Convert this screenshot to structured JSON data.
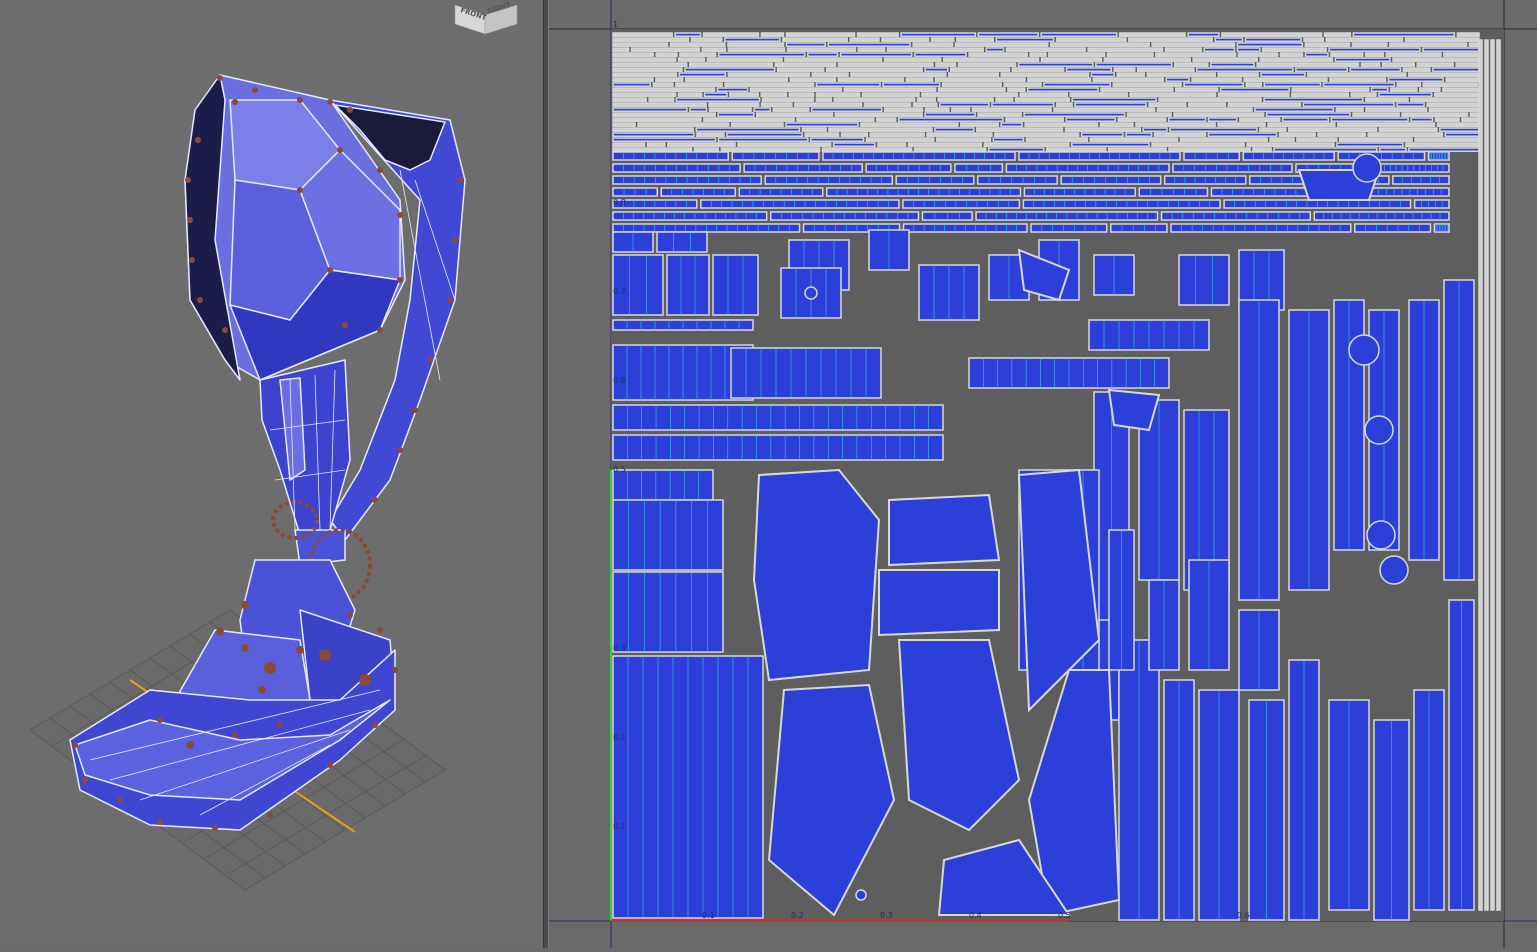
{
  "viewport": {
    "viewcube_face_front": "FRONT",
    "viewcube_face_right": "RIGHT"
  },
  "uv_editor": {
    "v_ticks": [
      "1",
      "0.9",
      "0.8",
      "0.7",
      "0.6",
      "0.5",
      "0.4",
      "0.3",
      "0.2",
      "0.1"
    ],
    "u_ticks": [
      "0.1",
      "0.2",
      "0.3",
      "0.4",
      "0.5",
      "0.6"
    ]
  },
  "colors": {
    "mesh_fill": "#3a44d8",
    "mesh_light": "#6a6fe0",
    "wire": "#e0e4ff",
    "seam": "#8a4a3a",
    "uv_shell": "#2c3fd8",
    "uv_grid_line": "#3fbfe8",
    "uv_border": "#d8d8d8"
  }
}
